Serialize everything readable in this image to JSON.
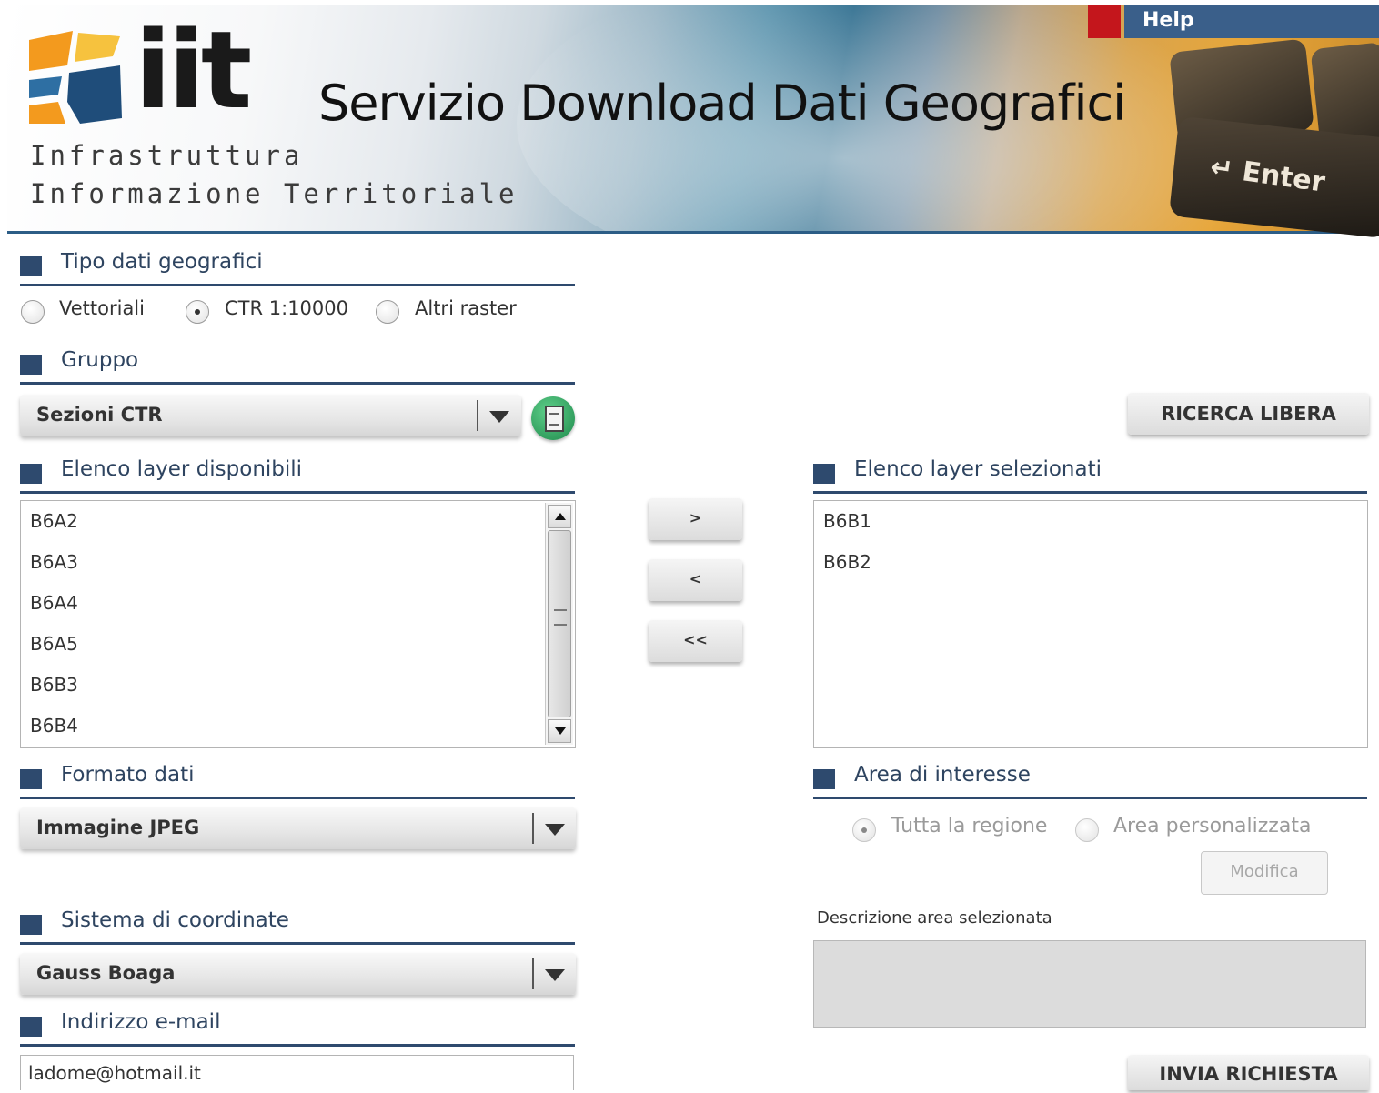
{
  "header": {
    "logo_word": "iit",
    "logo_line1": "Infrastruttura",
    "logo_line2": "Informazione Territoriale",
    "title": "Servizio Download Dati Geografici",
    "help_label": "Help",
    "enter_key_label": "Enter",
    "logo_colors": [
      "#f39a1e",
      "#2e6fa3",
      "#f6c23e",
      "#1f4d7a"
    ]
  },
  "tipo_dati": {
    "title": "Tipo dati geografici",
    "options": [
      {
        "label": "Vettoriali",
        "selected": false
      },
      {
        "label": "CTR 1:10000",
        "selected": true
      },
      {
        "label": "Altri raster",
        "selected": false
      }
    ]
  },
  "gruppo": {
    "title": "Gruppo",
    "selected": "Sezioni CTR"
  },
  "ricerca_libera_label": "RICERCA LIBERA",
  "layer_disponibili": {
    "title": "Elenco layer disponibili",
    "items": [
      "B6A2",
      "B6A3",
      "B6A4",
      "B6A5",
      "B6B3",
      "B6B4"
    ]
  },
  "transfer_buttons": {
    "add": ">",
    "remove": "<",
    "remove_all": "<<"
  },
  "layer_selezionati": {
    "title": "Elenco layer selezionati",
    "items": [
      "B6B1",
      "B6B2"
    ]
  },
  "formato_dati": {
    "title": "Formato dati",
    "selected": "Immagine JPEG"
  },
  "area_interesse": {
    "title": "Area di interesse",
    "options": [
      {
        "label": "Tutta la regione",
        "selected": true
      },
      {
        "label": "Area personalizzata",
        "selected": false
      }
    ],
    "modifica_label": "Modifica",
    "descrizione_label": "Descrizione area selezionata",
    "descrizione_value": ""
  },
  "sistema_coordinate": {
    "title": "Sistema di coordinate",
    "selected": "Gauss Boaga"
  },
  "email": {
    "title": "Indirizzo e-mail",
    "value": "ladome@hotmail.it"
  },
  "invia_label": "INVIA RICHIESTA",
  "accent_color": "#2e4a6e"
}
